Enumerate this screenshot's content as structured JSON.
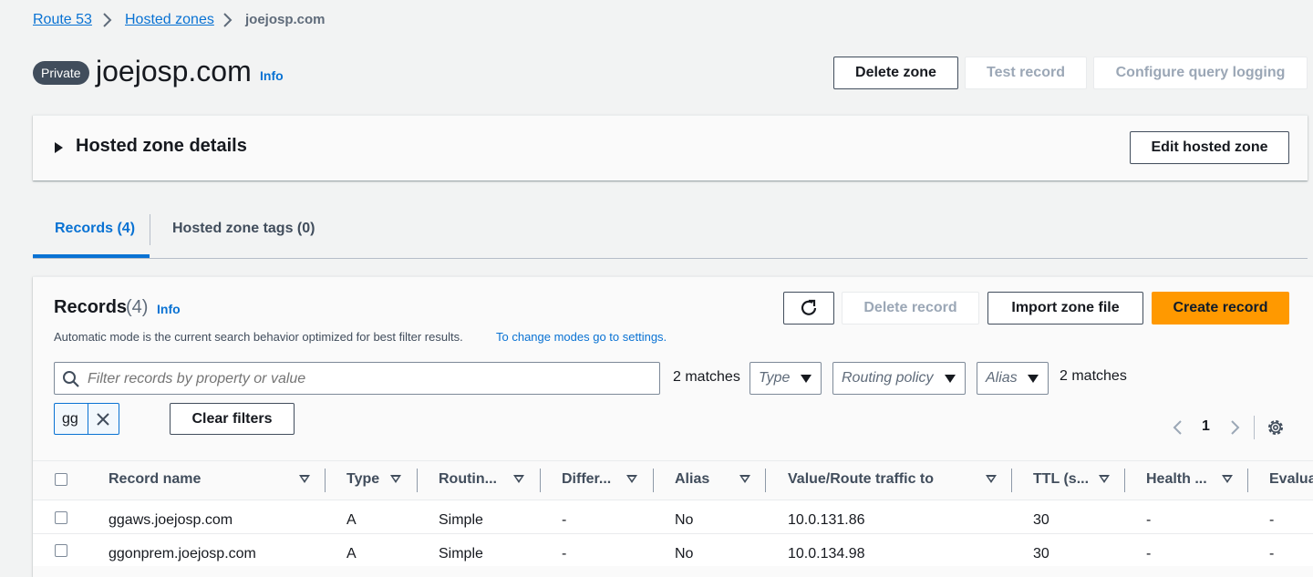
{
  "breadcrumb": {
    "items": [
      "Route 53",
      "Hosted zones"
    ],
    "current": "joejosp.com"
  },
  "header": {
    "badge": "Private",
    "title": "joejosp.com",
    "info": "Info",
    "buttons": {
      "delete_zone": "Delete zone",
      "test_record": "Test record",
      "configure_query_logging": "Configure query logging"
    }
  },
  "details_panel": {
    "title": "Hosted zone details",
    "edit_button": "Edit hosted zone"
  },
  "tabs": [
    {
      "label": "Records (4)",
      "active": true
    },
    {
      "label": "Hosted zone tags (0)",
      "active": false
    }
  ],
  "records": {
    "title": "Records",
    "count": "(4)",
    "info": "Info",
    "description": "Automatic mode is the current search behavior optimized for best filter results.",
    "description_link": "To change modes go to settings.",
    "buttons": {
      "refresh": "refresh-icon",
      "delete_record": "Delete record",
      "import_zone_file": "Import zone file",
      "create_record": "Create record"
    },
    "search": {
      "placeholder": "Filter records by property or value",
      "matches": "2 matches"
    },
    "filters": {
      "type": "Type",
      "routing_policy": "Routing policy",
      "alias": "Alias",
      "matches": "2 matches"
    },
    "token": "gg",
    "clear_filters": "Clear filters",
    "pagination": {
      "page": "1"
    },
    "columns": [
      "Record name",
      "Type",
      "Routin...",
      "Differ...",
      "Alias",
      "Value/Route traffic to",
      "TTL (s...",
      "Health ...",
      "Evalua"
    ],
    "rows": [
      {
        "name": "ggaws.joejosp.com",
        "type": "A",
        "routing": "Simple",
        "differ": "-",
        "alias": "No",
        "value": "10.0.131.86",
        "ttl": "30",
        "health": "-",
        "eval": "-"
      },
      {
        "name": "ggonprem.joejosp.com",
        "type": "A",
        "routing": "Simple",
        "differ": "-",
        "alias": "No",
        "value": "10.0.134.98",
        "ttl": "30",
        "health": "-",
        "eval": "-"
      }
    ]
  },
  "colors": {
    "link": "#0972d3",
    "primary": "#ff9900",
    "background": "#f2f3f3",
    "badge": "#414d5c"
  }
}
